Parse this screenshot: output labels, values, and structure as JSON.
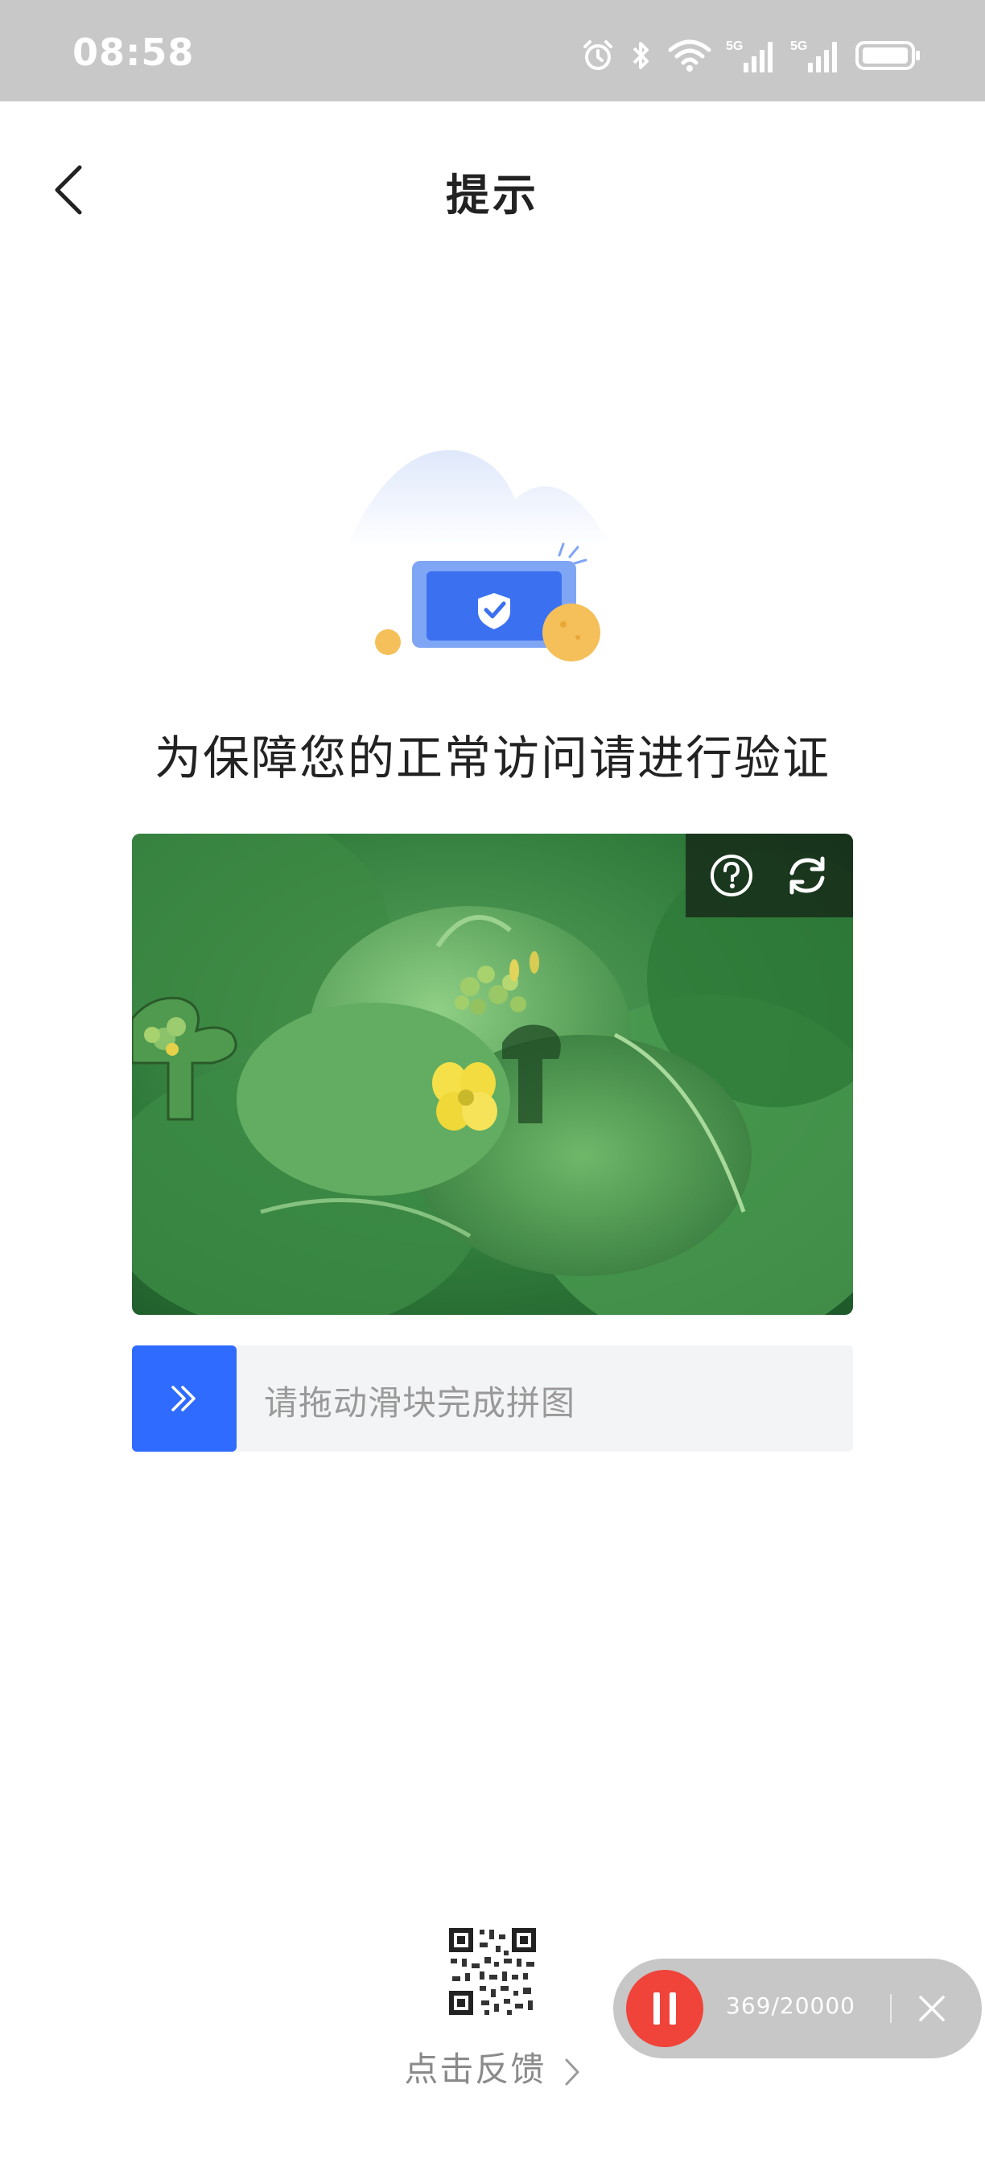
{
  "status_bar": {
    "time": "08:58",
    "icons": [
      "alarm-icon",
      "bluetooth-icon",
      "wifi-icon",
      "signal-5g-icon",
      "signal-5g-icon",
      "battery-icon"
    ],
    "network_labels": [
      "5G",
      "5G"
    ]
  },
  "header": {
    "title": "提示",
    "back_icon": "chevron-left-icon"
  },
  "verify": {
    "prompt": "为保障您的正常访问请进行验证",
    "help_icon": "help-icon",
    "refresh_icon": "refresh-icon"
  },
  "slider": {
    "hint": "请拖动滑块完成拼图",
    "handle_icon": "double-chevron-right-icon"
  },
  "feedback": {
    "label": "点击反馈"
  },
  "recorder": {
    "count": "369/20000",
    "pause_icon": "pause-icon",
    "close_icon": "close-icon"
  },
  "colors": {
    "accent": "#2f6bff",
    "status_bar_bg": "#c8c8c8",
    "recorder_red": "#f0433a",
    "slider_track": "#f3f4f6"
  }
}
